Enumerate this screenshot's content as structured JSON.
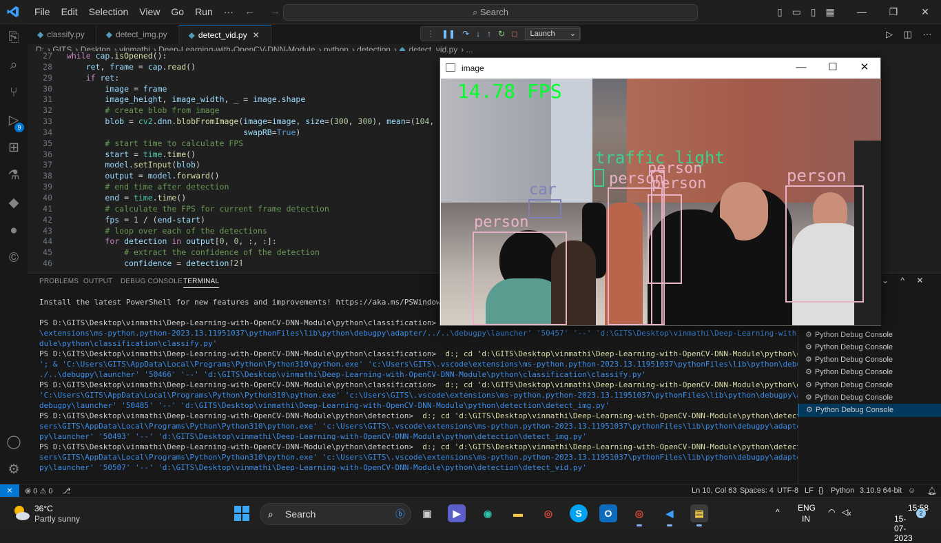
{
  "menu": [
    "File",
    "Edit",
    "Selection",
    "View",
    "Go",
    "Run",
    "···"
  ],
  "search_placeholder": "Search",
  "tabs": [
    {
      "label": "classify.py",
      "active": false
    },
    {
      "label": "detect_img.py",
      "active": false
    },
    {
      "label": "detect_vid.py",
      "active": true
    }
  ],
  "debug": {
    "config": "Launch"
  },
  "breadcrumb": [
    "D:",
    "GITS",
    "Desktop",
    "vinmathi",
    "Deep-Learning-with-OpenCV-DNN-Module",
    "python",
    "detection",
    "detect_vid.py",
    "..."
  ],
  "code_lines": [
    {
      "n": "27",
      "html": "<span class='kw'>while</span> <span class='var'>cap</span>.<span class='fn'>isOpened</span>():"
    },
    {
      "n": "28",
      "html": "    <span class='var'>ret</span>, <span class='var'>frame</span> = <span class='var'>cap</span>.<span class='fn'>read</span>()"
    },
    {
      "n": "29",
      "html": "    <span class='kw'>if</span> <span class='var'>ret</span>:"
    },
    {
      "n": "30",
      "html": "        <span class='var'>image</span> = <span class='var'>frame</span>"
    },
    {
      "n": "31",
      "html": "        <span class='var'>image_height</span>, <span class='var'>image_width</span>, <span class='var'>_</span> = <span class='var'>image</span>.<span class='var'>shape</span>"
    },
    {
      "n": "32",
      "html": "        <span class='cm'># create blob from image</span>"
    },
    {
      "n": "33",
      "html": "        <span class='var'>blob</span> = <span class='cl'>cv2</span>.<span class='var'>dnn</span>.<span class='fn'>blobFromImage</span>(<span class='var'>image</span>=<span class='var'>image</span>, <span class='var'>size</span>=(<span class='num'>300</span>, <span class='num'>300</span>), <span class='var'>mean</span>=(<span class='num'>104</span>, <span class='num'>117</span>, <span class='num'>123</span>),"
    },
    {
      "n": "34",
      "html": "                                     <span class='var'>swapRB</span>=<span class='bool'>True</span>)"
    },
    {
      "n": "35",
      "html": "        <span class='cm'># start time to calculate FPS</span>"
    },
    {
      "n": "36",
      "html": "        <span class='var'>start</span> = <span class='cl'>time</span>.<span class='fn'>time</span>()"
    },
    {
      "n": "37",
      "html": "        <span class='var'>model</span>.<span class='fn'>setInput</span>(<span class='var'>blob</span>)"
    },
    {
      "n": "38",
      "html": "        <span class='var'>output</span> = <span class='var'>model</span>.<span class='fn'>forward</span>()"
    },
    {
      "n": "39",
      "html": "        <span class='cm'># end time after detection</span>"
    },
    {
      "n": "40",
      "html": "        <span class='var'>end</span> = <span class='cl'>time</span>.<span class='fn'>time</span>()"
    },
    {
      "n": "41",
      "html": "        <span class='cm'># calculate the FPS for current frame detection</span>"
    },
    {
      "n": "42",
      "html": "        <span class='var'>fps</span> = <span class='num'>1</span> / (<span class='var'>end</span>-<span class='var'>start</span>)"
    },
    {
      "n": "43",
      "html": "        <span class='cm'># loop over each of the detections</span>"
    },
    {
      "n": "44",
      "html": "        <span class='kw'>for</span> <span class='var'>detection</span> <span class='kw'>in</span> <span class='var'>output</span>[<span class='num'>0</span>, <span class='num'>0</span>, :, :]:"
    },
    {
      "n": "45",
      "html": "            <span class='cm'># extract the confidence of the detection</span>"
    },
    {
      "n": "46",
      "html": "            <span class='var'>confidence</span> = <span class='var'>detection</span>[<span class='num'>2</span>]"
    }
  ],
  "panel_tabs": [
    "PROBLEMS",
    "OUTPUT",
    "DEBUG CONSOLE",
    "TERMINAL"
  ],
  "terminal_lines": [
    "Install the latest PowerShell for new features and improvements! https://aka.ms/PSWindows",
    "",
    "PS D:\\GITS\\Desktop\\vinmathi\\Deep-Learning-with-OpenCV-DNN-Module\\python\\classification>  & 'C:\\Us",
    "\\extensions\\ms-python.python-2023.13.11951037\\pythonFiles\\lib\\python\\debugpy\\adapter/../..\\debugpy\\launcher' '50457' '--' 'd:\\GITS\\Desktop\\vinmathi\\Deep-Learning-with-OpenCV-DNN-Mo",
    "dule\\python\\classification\\classify.py'",
    "PS D:\\GITS\\Desktop\\vinmathi\\Deep-Learning-with-OpenCV-DNN-Module\\python\\classification>  d:; cd 'd:\\GITS\\Desktop\\vinmathi\\Deep-Learning-with-OpenCV-DNN-Module\\python\\classification",
    "'; & 'C:\\Users\\GITS\\AppData\\Local\\Programs\\Python\\Python310\\python.exe' 'c:\\Users\\GITS\\.vscode\\extensions\\ms-python.python-2023.13.11951037\\pythonFiles\\lib\\python\\debugpy\\adapter/.",
    "./..\\debugpy\\launcher' '50466' '--' 'd:\\GITS\\Desktop\\vinmathi\\Deep-Learning-with-OpenCV-DNN-Module\\python\\classification\\classify.py'",
    "PS D:\\GITS\\Desktop\\vinmathi\\Deep-Learning-with-OpenCV-DNN-Module\\python\\classification>  d:; cd 'd:\\GITS\\Desktop\\vinmathi\\Deep-Learning-with-OpenCV-DNN-Module\\python\\detection'; &",
    "'C:\\Users\\GITS\\AppData\\Local\\Programs\\Python\\Python310\\python.exe' 'c:\\Users\\GITS\\.vscode\\extensions\\ms-python.python-2023.13.11951037\\pythonFiles\\lib\\python\\debugpy\\adapter/../..\\",
    "debugpy\\launcher' '50485' '--' 'd:\\GITS\\Desktop\\vinmathi\\Deep-Learning-with-OpenCV-DNN-Module\\python\\detection\\detect_img.py'",
    "PS D:\\GITS\\Desktop\\vinmathi\\Deep-Learning-with-OpenCV-DNN-Module\\python\\detection>  d:; cd 'd:\\GITS\\Desktop\\vinmathi\\Deep-Learning-with-OpenCV-DNN-Module\\python\\detection'; & 'C:\\U",
    "sers\\GITS\\AppData\\Local\\Programs\\Python\\Python310\\python.exe' 'c:\\Users\\GITS\\.vscode\\extensions\\ms-python.python-2023.13.11951037\\pythonFiles\\lib\\python\\debugpy\\adapter/../..\\debug",
    "py\\launcher' '50493' '--' 'd:\\GITS\\Desktop\\vinmathi\\Deep-Learning-with-OpenCV-DNN-Module\\python\\detection\\detect_img.py'",
    "PS D:\\GITS\\Desktop\\vinmathi\\Deep-Learning-with-OpenCV-DNN-Module\\python\\detection>  d:; cd 'd:\\GITS\\Desktop\\vinmathi\\Deep-Learning-with-OpenCV-DNN-Module\\python\\detection'; & 'C:\\U",
    "sers\\GITS\\AppData\\Local\\Programs\\Python\\Python310\\python.exe' 'c:\\Users\\GITS\\.vscode\\extensions\\ms-python.python-2023.13.11951037\\pythonFiles\\lib\\python\\debugpy\\adapter/../..\\debug",
    "py\\launcher' '50507' '--' 'd:\\GITS\\Desktop\\vinmathi\\Deep-Learning-with-OpenCV-DNN-Module\\python\\detection\\detect_vid.py'"
  ],
  "terminal_list": [
    {
      "label": "Python Debug Console",
      "partial": "ole",
      "selected": false
    },
    {
      "label": "Python Debug Console",
      "partial": "ole",
      "selected": false
    },
    {
      "label": "Python Debug Console",
      "selected": false
    },
    {
      "label": "Python Debug Console",
      "selected": false
    },
    {
      "label": "Python Debug Console",
      "selected": false
    },
    {
      "label": "Python Debug Console",
      "selected": false
    },
    {
      "label": "Python Debug Console",
      "selected": false
    },
    {
      "label": "Python Debug Console",
      "selected": false
    },
    {
      "label": "Python Debug Console",
      "selected": true
    }
  ],
  "status": {
    "problems": "⊗ 0 ⚠ 0",
    "cursor": "Ln 10, Col 63",
    "spaces": "Spaces: 4",
    "encoding": "UTF-8",
    "eol": "LF",
    "language": "Python",
    "interpreter": "3.10.9 64-bit"
  },
  "image_window": {
    "title": "image",
    "fps": "14.78 FPS",
    "labels": [
      "traffic light",
      "person",
      "person",
      "person",
      "person",
      "person",
      "car"
    ]
  },
  "taskbar": {
    "temp": "36°C",
    "weather": "Partly sunny",
    "search": "Search",
    "lang1": "ENG",
    "lang2": "IN",
    "time": "15:58",
    "date": "15-07-2023",
    "notifications": "2"
  },
  "colors": {
    "accent": "#0078d4",
    "fps_text": "#00ff2a",
    "bbox": "#e8b2c6"
  }
}
